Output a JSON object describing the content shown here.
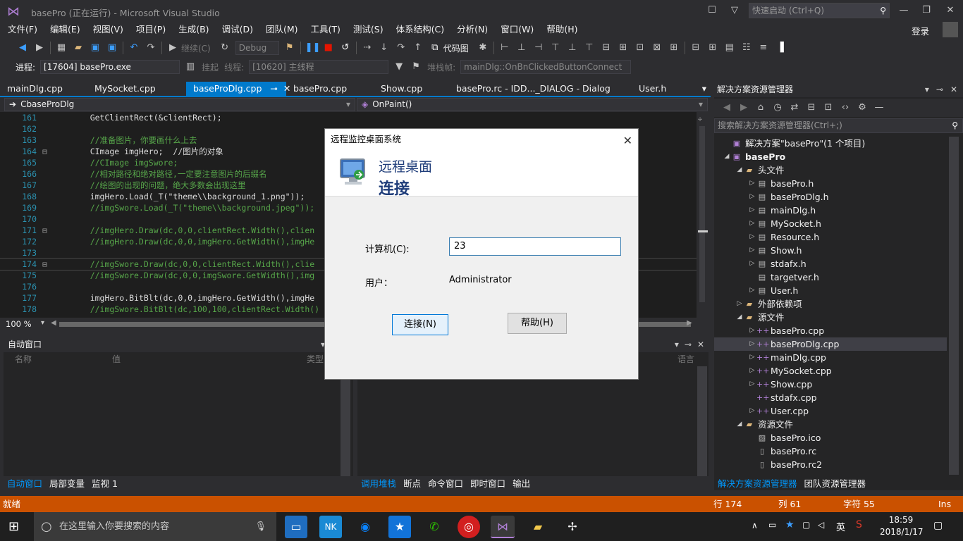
{
  "window": {
    "title": "basePro (正在运行) - Microsoft Visual Studio",
    "quick_launch_placeholder": "快速启动 (Ctrl+Q)",
    "login": "登录"
  },
  "menu": [
    "文件(F)",
    "编辑(E)",
    "视图(V)",
    "项目(P)",
    "生成(B)",
    "调试(D)",
    "团队(M)",
    "工具(T)",
    "测试(S)",
    "体系结构(C)",
    "分析(N)",
    "窗口(W)",
    "帮助(H)"
  ],
  "toolbar": {
    "continue_label": "继续(C)",
    "config_value": "Debug",
    "codemap_label": "代码图",
    "process_label": "进程:",
    "process_value": "[17604] basePro.exe",
    "suspend_label": "挂起",
    "thread_label": "线程:",
    "thread_value": "[10620] 主线程",
    "stackframe_label": "堆栈帧:",
    "stackframe_value": "mainDlg::OnBnClickedButtonConnect"
  },
  "tabs": [
    "mainDlg.cpp",
    "MySocket.cpp",
    "baseProDlg.cpp",
    "basePro.cpp",
    "Show.cpp",
    "basePro.rc - IDD..._DIALOG - Dialog",
    "User.h"
  ],
  "active_tab_index": 2,
  "navbar": {
    "class_value": "CbaseProDlg",
    "member_value": "OnPaint()"
  },
  "code_lines": [
    {
      "num": "161",
      "text": "    GetClientRect(&clientRect);",
      "comment": false
    },
    {
      "num": "162",
      "text": "",
      "comment": false
    },
    {
      "num": "163",
      "text": "    //准备图片，你要画什么上去",
      "comment": true
    },
    {
      "num": "164",
      "text": "    CImage imgHero;  //图片的对象",
      "comment": false
    },
    {
      "num": "165",
      "text": "    //CImage imgSwore;",
      "comment": true
    },
    {
      "num": "166",
      "text": "    //相对路径和绝对路径,一定要注意图片的后缀名",
      "comment": true
    },
    {
      "num": "167",
      "text": "    //绘图的出现的问题，绝大多数会出现这里",
      "comment": true
    },
    {
      "num": "168",
      "text": "    imgHero.Load(_T(\"theme\\\\background_1.png\"));",
      "comment": false
    },
    {
      "num": "169",
      "text": "    //imgSwore.Load(_T(\"theme\\\\background.jpeg\"));",
      "comment": true
    },
    {
      "num": "170",
      "text": "",
      "comment": false
    },
    {
      "num": "171",
      "text": "    //imgHero.Draw(dc,0,0,clientRect.Width(),clien",
      "comment": true
    },
    {
      "num": "172",
      "text": "    //imgHero.Draw(dc,0,0,imgHero.GetWidth(),imgHe",
      "comment": true
    },
    {
      "num": "173",
      "text": "",
      "comment": false
    },
    {
      "num": "174",
      "text": "    //imgSwore.Draw(dc,0,0,clientRect.Width(),clie",
      "comment": true
    },
    {
      "num": "175",
      "text": "    //imgSwore.Draw(dc,0,0,imgSwore.GetWidth(),img",
      "comment": true
    },
    {
      "num": "176",
      "text": "",
      "comment": false
    },
    {
      "num": "177",
      "text": "    imgHero.BitBlt(dc,0,0,imgHero.GetWidth(),imgHe",
      "comment": false
    },
    {
      "num": "178",
      "text": "    //imgSwore.BitBlt(dc,100,100,clientRect.Width()",
      "comment": true
    }
  ],
  "zoom": "100 %",
  "autos": {
    "title": "自动窗口",
    "col_name": "名称",
    "col_value": "值",
    "col_type": "类型",
    "tabs": [
      "自动窗口",
      "局部变量",
      "监视 1"
    ]
  },
  "callstack": {
    "col_lang": "语言",
    "tabs": [
      "调用堆栈",
      "断点",
      "命令窗口",
      "即时窗口",
      "输出"
    ]
  },
  "solution_explorer": {
    "title": "解决方案资源管理器",
    "search_placeholder": "搜索解决方案资源管理器(Ctrl+;)",
    "items": [
      {
        "label": "解决方案\"basePro\"(1 个项目)",
        "icon": "solution-icon",
        "level": 0,
        "arrow": ""
      },
      {
        "label": "basePro",
        "icon": "project-icon",
        "level": 0,
        "arrow": "▲"
      },
      {
        "label": "头文件",
        "icon": "folder-icon",
        "level": 1,
        "arrow": "▲"
      },
      {
        "label": "basePro.h",
        "icon": "header-file-icon",
        "level": 2,
        "arrow": "▷"
      },
      {
        "label": "baseProDlg.h",
        "icon": "header-file-icon",
        "level": 2,
        "arrow": "▷"
      },
      {
        "label": "mainDlg.h",
        "icon": "header-file-icon",
        "level": 2,
        "arrow": "▷"
      },
      {
        "label": "MySocket.h",
        "icon": "header-file-icon",
        "level": 2,
        "arrow": "▷"
      },
      {
        "label": "Resource.h",
        "icon": "header-file-icon",
        "level": 2,
        "arrow": "▷"
      },
      {
        "label": "Show.h",
        "icon": "header-file-icon",
        "level": 2,
        "arrow": "▷"
      },
      {
        "label": "stdafx.h",
        "icon": "header-file-icon",
        "level": 2,
        "arrow": "▷"
      },
      {
        "label": "targetver.h",
        "icon": "header-file-icon",
        "level": 2,
        "arrow": ""
      },
      {
        "label": "User.h",
        "icon": "header-file-icon",
        "level": 2,
        "arrow": "▷"
      },
      {
        "label": "外部依赖项",
        "icon": "folder-icon",
        "level": 1,
        "arrow": "▷"
      },
      {
        "label": "源文件",
        "icon": "folder-icon",
        "level": 1,
        "arrow": "▲"
      },
      {
        "label": "basePro.cpp",
        "icon": "cpp-file-icon",
        "level": 2,
        "arrow": "▷"
      },
      {
        "label": "baseProDlg.cpp",
        "icon": "cpp-file-icon",
        "level": 2,
        "arrow": "▷"
      },
      {
        "label": "mainDlg.cpp",
        "icon": "cpp-file-icon",
        "level": 2,
        "arrow": "▷"
      },
      {
        "label": "MySocket.cpp",
        "icon": "cpp-file-icon",
        "level": 2,
        "arrow": "▷"
      },
      {
        "label": "Show.cpp",
        "icon": "cpp-file-icon",
        "level": 2,
        "arrow": "▷"
      },
      {
        "label": "stdafx.cpp",
        "icon": "cpp-file-icon",
        "level": 2,
        "arrow": ""
      },
      {
        "label": "User.cpp",
        "icon": "cpp-file-icon",
        "level": 2,
        "arrow": "▷"
      },
      {
        "label": "资源文件",
        "icon": "folder-icon",
        "level": 1,
        "arrow": "▲"
      },
      {
        "label": "basePro.ico",
        "icon": "image-file-icon",
        "level": 2,
        "arrow": ""
      },
      {
        "label": "basePro.rc",
        "icon": "resource-file-icon",
        "level": 2,
        "arrow": ""
      },
      {
        "label": "basePro.rc2",
        "icon": "resource-file-icon",
        "level": 2,
        "arrow": ""
      }
    ],
    "selected_index": 15,
    "tabs": [
      "解决方案资源管理器",
      "团队资源管理器"
    ]
  },
  "status": {
    "ready": "就绪",
    "line": "行 174",
    "col": "列 61",
    "char": "字符 55",
    "mode": "Ins"
  },
  "taskbar": {
    "search_placeholder": "在这里输入你要搜索的内容",
    "time": "18:59",
    "date": "2018/1/17",
    "ime": "英"
  },
  "dialog": {
    "title": "远程监控桌面系统",
    "banner_line1": "远程桌面",
    "banner_line2": "连接",
    "computer_label": "计算机(C):",
    "computer_value": "23",
    "user_label": "用户：",
    "user_value": "Administrator",
    "connect_button": "连接(N)",
    "help_button": "帮助(H)"
  },
  "colors": {
    "accent": "#007acc",
    "status_bar": "#ca5100",
    "editor_bg": "#1e1e1e",
    "comment": "#57a64a"
  }
}
